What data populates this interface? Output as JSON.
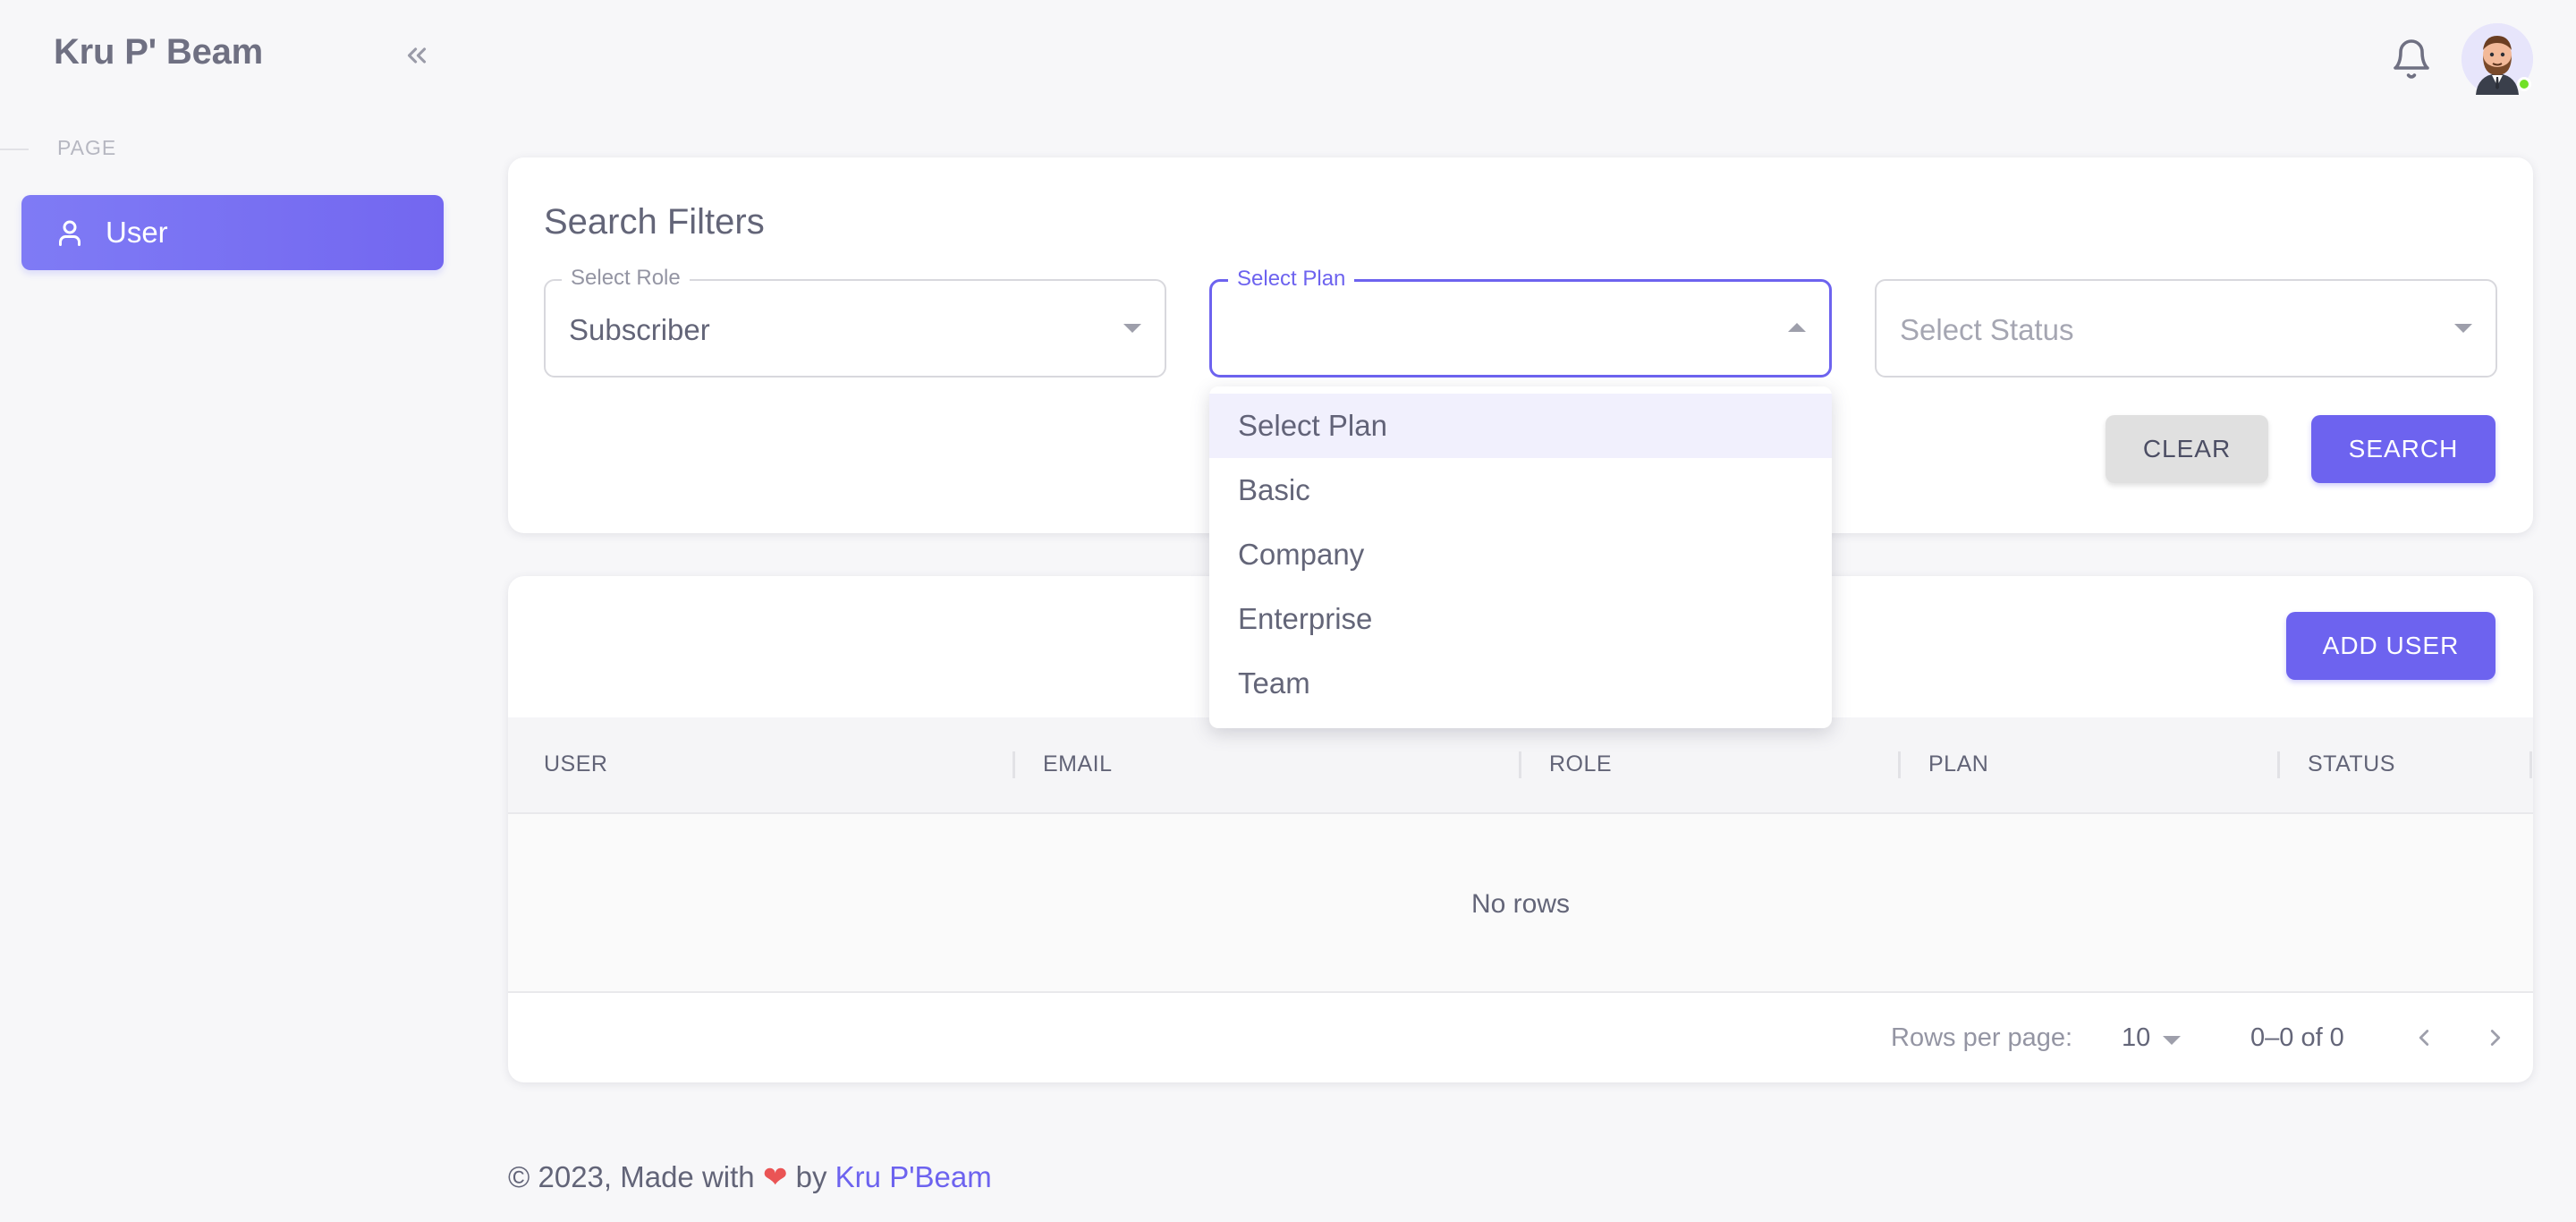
{
  "sidebar": {
    "brand": "Kru P' Beam",
    "section_label": "PAGE",
    "items": [
      {
        "label": "User",
        "icon": "user-icon",
        "active": true
      }
    ]
  },
  "topbar": {
    "notification_icon": "bell-icon",
    "avatar_status": "online",
    "status_color": "#72e128"
  },
  "filters": {
    "title": "Search Filters",
    "role": {
      "legend": "Select Role",
      "value": "Subscriber"
    },
    "plan": {
      "legend": "Select Plan",
      "value": ""
    },
    "status": {
      "placeholder": "Select Status",
      "value": ""
    },
    "clear_label": "CLEAR",
    "search_label": "SEARCH"
  },
  "plan_dropdown": {
    "options": [
      "Select Plan",
      "Basic",
      "Company",
      "Enterprise",
      "Team"
    ],
    "highlighted": "Select Plan"
  },
  "table": {
    "add_label": "ADD USER",
    "columns": [
      "USER",
      "EMAIL",
      "ROLE",
      "PLAN",
      "STATUS"
    ],
    "empty_text": "No rows",
    "rows_per_page_label": "Rows per page:",
    "rows_per_page": "10",
    "range_text": "0–0 of 0"
  },
  "footer": {
    "prefix": "© 2023, Made with",
    "by": "by",
    "author": "Kru P'Beam"
  },
  "colors": {
    "primary": "#6d63ef",
    "heart": "#ea5455",
    "background": "#f7f7f9"
  }
}
